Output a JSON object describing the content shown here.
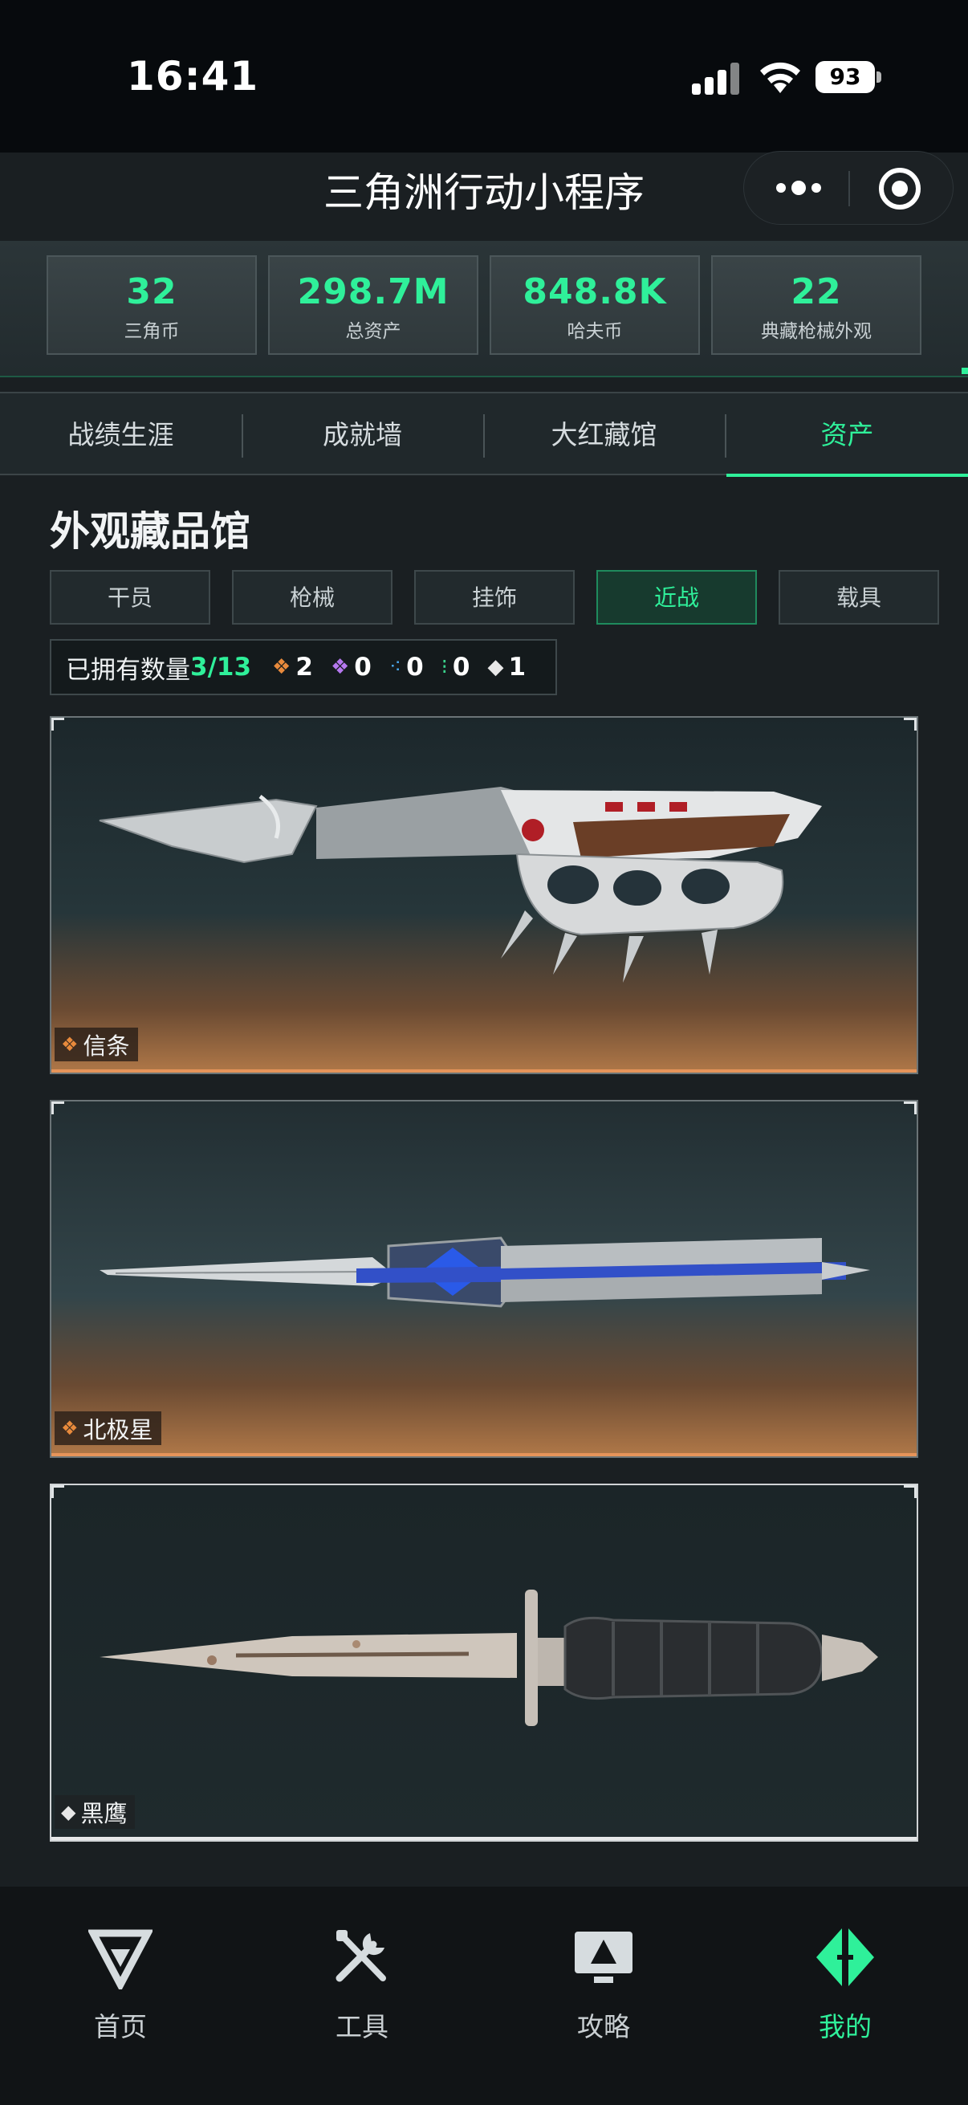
{
  "status_bar": {
    "time": "16:41",
    "battery": "93"
  },
  "nav": {
    "title": "三角洲行动小程序"
  },
  "stats": [
    {
      "value": "32",
      "label": "三角币"
    },
    {
      "value": "298.7M",
      "label": "总资产"
    },
    {
      "value": "848.8K",
      "label": "哈夫币"
    },
    {
      "value": "22",
      "label": "典藏枪械外观"
    }
  ],
  "main_tabs": [
    {
      "label": "战绩生涯",
      "active": false
    },
    {
      "label": "成就墙",
      "active": false
    },
    {
      "label": "大红藏馆",
      "active": false
    },
    {
      "label": "资产",
      "active": true
    }
  ],
  "section": {
    "title": "外观藏品馆"
  },
  "sub_tabs": [
    {
      "label": "干员",
      "active": false
    },
    {
      "label": "枪械",
      "active": false
    },
    {
      "label": "挂饰",
      "active": false
    },
    {
      "label": "近战",
      "active": true
    },
    {
      "label": "载具",
      "active": false
    }
  ],
  "owned": {
    "label": "已拥有数量",
    "count": "3/13",
    "rarities": [
      {
        "icon": "orange-diamond-icon",
        "color": "#e88a3c",
        "count": "2"
      },
      {
        "icon": "purple-diamond-icon",
        "color": "#b678f0",
        "count": "0"
      },
      {
        "icon": "blue-diamond-icon",
        "color": "#4aa8f0",
        "count": "0"
      },
      {
        "icon": "green-diamond-icon",
        "color": "#3ad08a",
        "count": "0"
      },
      {
        "icon": "white-diamond-icon",
        "color": "#e8e8e8",
        "count": "1"
      }
    ]
  },
  "items": [
    {
      "name": "信条",
      "rarity_color": "#e88a3c"
    },
    {
      "name": "北极星",
      "rarity_color": "#e88a3c"
    },
    {
      "name": "黑鹰",
      "rarity_color": "#e8e8e8"
    }
  ],
  "bottom_nav": [
    {
      "label": "首页",
      "icon": "delta-logo-icon",
      "active": false
    },
    {
      "label": "工具",
      "icon": "tools-icon",
      "active": false
    },
    {
      "label": "攻略",
      "icon": "monitor-guide-icon",
      "active": false
    },
    {
      "label": "我的",
      "icon": "profile-diamond-icon",
      "active": true
    }
  ],
  "colors": {
    "accent": "#2ff09a",
    "background": "#1a1f22"
  }
}
